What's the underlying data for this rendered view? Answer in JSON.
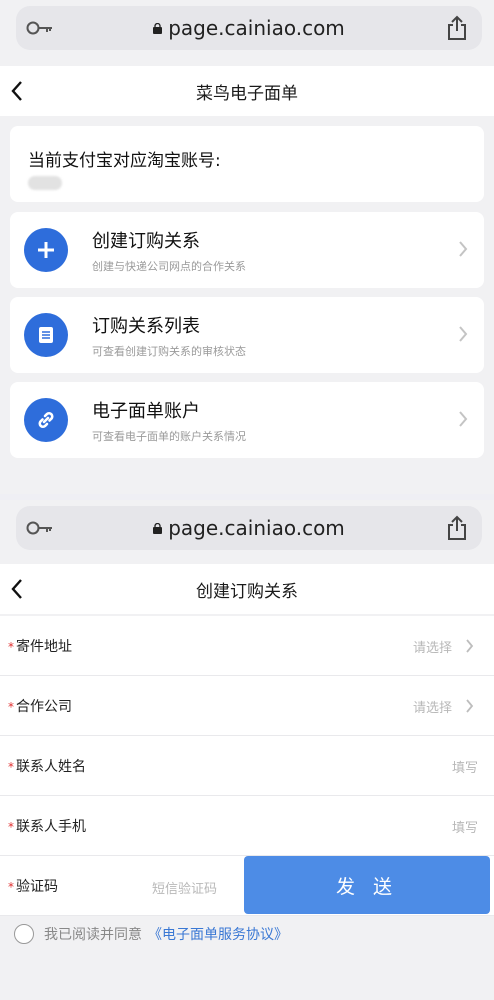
{
  "screen1": {
    "url": "page.cainiao.com",
    "nav_title": "菜鸟电子面单",
    "account_label": "当前支付宝对应淘宝账号:",
    "menu": [
      {
        "title": "创建订购关系",
        "subtitle": "创建与快递公司网点的合作关系",
        "icon": "plus-icon"
      },
      {
        "title": "订购关系列表",
        "subtitle": "可查看创建订购关系的审核状态",
        "icon": "list-icon"
      },
      {
        "title": "电子面单账户",
        "subtitle": "可查看电子面单的账户关系情况",
        "icon": "link-icon"
      }
    ]
  },
  "screen2": {
    "url": "page.cainiao.com",
    "nav_title": "创建订购关系",
    "form": {
      "sender_address": {
        "label": "寄件地址",
        "placeholder": "请选择"
      },
      "partner_company": {
        "label": "合作公司",
        "placeholder": "请选择"
      },
      "contact_name": {
        "label": "联系人姓名",
        "placeholder": "填写"
      },
      "contact_phone": {
        "label": "联系人手机",
        "placeholder": "填写"
      },
      "verify_code": {
        "label": "验证码",
        "placeholder": "短信验证码",
        "send_label": "发 送"
      }
    },
    "agreement": {
      "text": "我已阅读并同意",
      "link": "《电子面单服务协议》"
    }
  },
  "colors": {
    "accent": "#2e6ddb",
    "send_button": "#4d8ce6",
    "required": "#e03131",
    "link": "#3a78d4"
  }
}
